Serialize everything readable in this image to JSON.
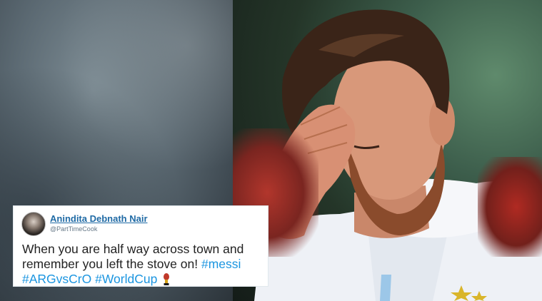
{
  "tweet": {
    "display_name": "Anindita Debnath Nair",
    "handle": "@PartTimeCook",
    "text_line1": "When you are half way across town and",
    "text_line2_pre": "remember you left the stove on! ",
    "hashtag_1": "#messi",
    "hashtag_2": "#ARGvsCrO",
    "hashtag_3": "#WorldCup",
    "emoji_icon": "trophy-icon"
  },
  "colors": {
    "link": "#1b95e0",
    "name": "#1f6aa5",
    "card_bg": "#ffffff",
    "shirt": "#f2f4f8"
  }
}
